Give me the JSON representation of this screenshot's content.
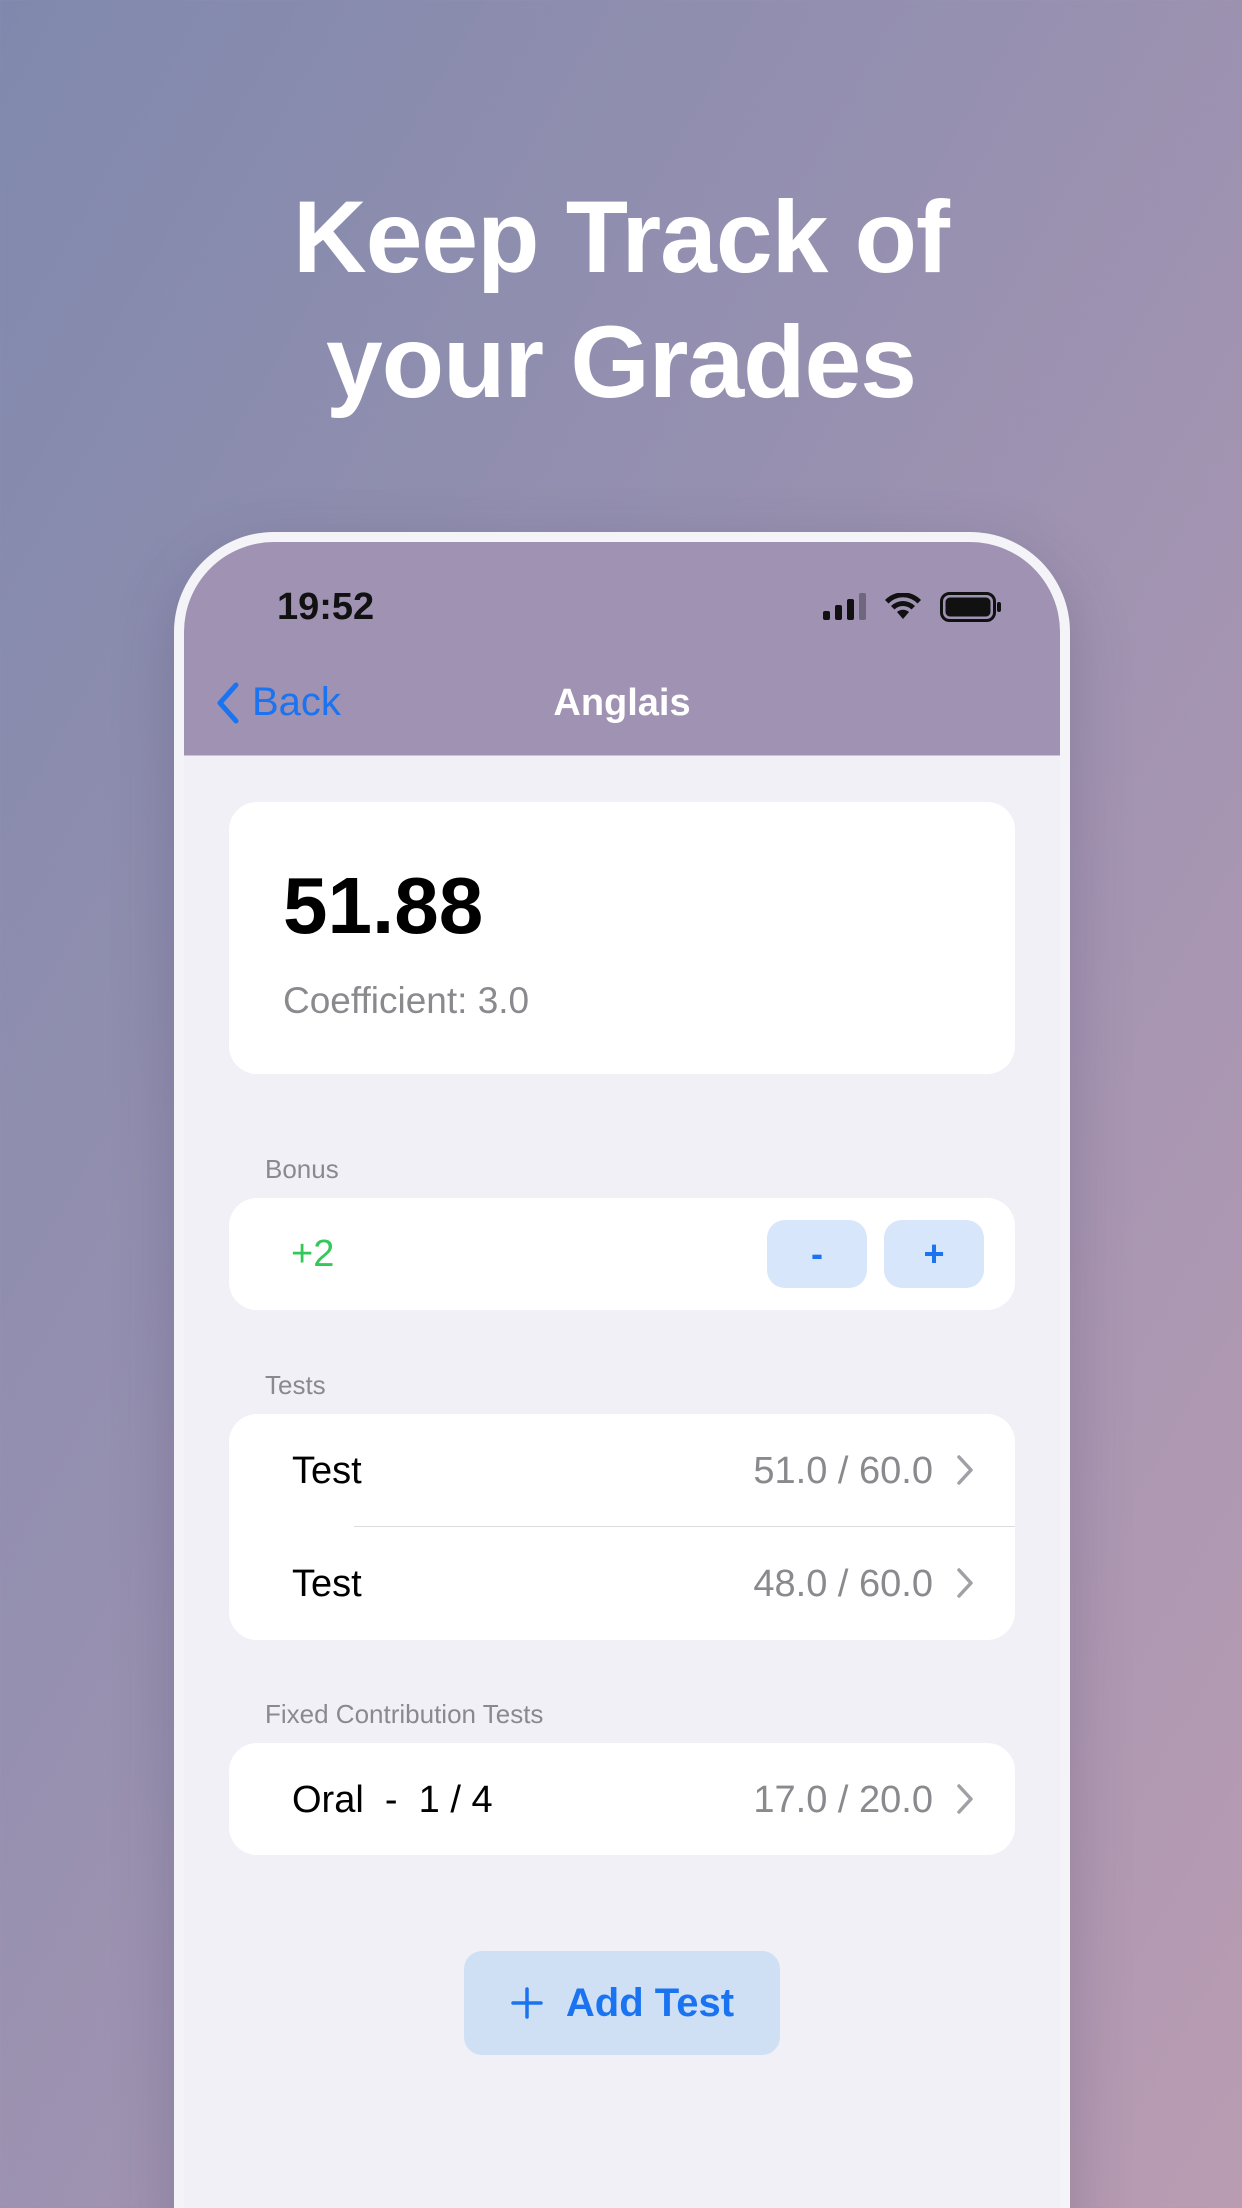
{
  "headline": {
    "line1": "Keep Track of",
    "line2": "your Grades"
  },
  "status_bar": {
    "time": "19:52"
  },
  "navbar": {
    "back_label": "Back",
    "title": "Anglais"
  },
  "grade": {
    "value": "51.88",
    "coefficient": "Coefficient: 3.0"
  },
  "bonus": {
    "section_label": "Bonus",
    "value": "+2",
    "minus_label": "-",
    "plus_label": "+"
  },
  "tests": {
    "section_label": "Tests",
    "items": [
      {
        "name": "Test",
        "score": "51.0 / 60.0"
      },
      {
        "name": "Test",
        "score": "48.0 / 60.0"
      }
    ]
  },
  "fixed_tests": {
    "section_label": "Fixed Contribution Tests",
    "items": [
      {
        "name": "Oral  -  1 / 4",
        "score": "17.0 / 20.0"
      }
    ]
  },
  "add_test": {
    "label": "Add Test"
  },
  "colors": {
    "accent": "#1a73f0",
    "bonus_positive": "#34c759",
    "navbar": "#9f92b2"
  },
  "icons": {
    "back": "chevron-left-icon",
    "row": "chevron-right-icon",
    "add": "plus-icon"
  }
}
